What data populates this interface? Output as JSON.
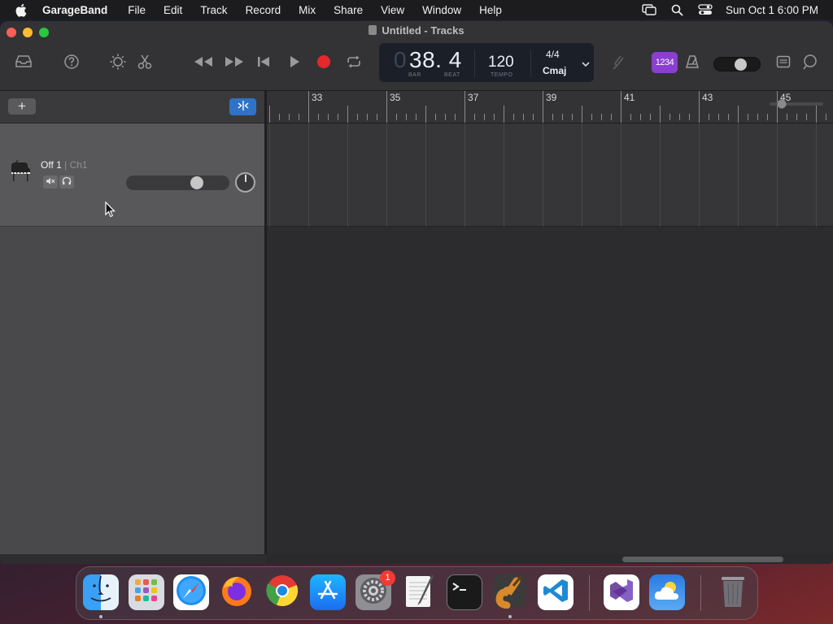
{
  "menubar": {
    "app_name": "GarageBand",
    "items": [
      "File",
      "Edit",
      "Track",
      "Record",
      "Mix",
      "Share",
      "View",
      "Window",
      "Help"
    ],
    "clock": "Sun Oct 1  6:00 PM",
    "status_icons": [
      "screen-mirroring-icon",
      "spotlight-search-icon",
      "control-center-icon"
    ]
  },
  "window": {
    "title": "Untitled - Tracks"
  },
  "toolbar": {
    "lcd": {
      "ghost_digit": "0",
      "position": "38. 4",
      "bar_label": "BAR",
      "beat_label": "BEAT",
      "tempo": "120",
      "tempo_label": "TEMPO",
      "time_signature": "4/4",
      "key": "Cmaj"
    },
    "count_in_label": "1234",
    "record_color": "#e5282c",
    "count_in_color": "#8a3fd0",
    "master_volume": 0.6
  },
  "tracks": {
    "items": [
      {
        "name": "Off 1",
        "channel": "| Ch1",
        "volume": 0.72,
        "instrument_icon": "grand-piano-icon"
      }
    ]
  },
  "ruler": {
    "bars": [
      "33",
      "35",
      "37",
      "39",
      "41",
      "43",
      "45"
    ]
  },
  "dock": {
    "apps": [
      {
        "name": "Finder",
        "running": true
      },
      {
        "name": "Launchpad",
        "running": false
      },
      {
        "name": "Safari",
        "running": false
      },
      {
        "name": "Firefox",
        "running": false
      },
      {
        "name": "Chrome",
        "running": false
      },
      {
        "name": "App Store",
        "running": false
      },
      {
        "name": "System Settings",
        "running": false,
        "badge": "1"
      },
      {
        "name": "TextEdit",
        "running": false
      },
      {
        "name": "Terminal",
        "running": false
      },
      {
        "name": "GarageBand",
        "running": true
      },
      {
        "name": "Visual Studio Code",
        "running": false
      },
      {
        "name": "Visual Studio",
        "running": false
      },
      {
        "name": "Weather",
        "running": false
      },
      {
        "name": "Trash",
        "running": false
      }
    ]
  }
}
